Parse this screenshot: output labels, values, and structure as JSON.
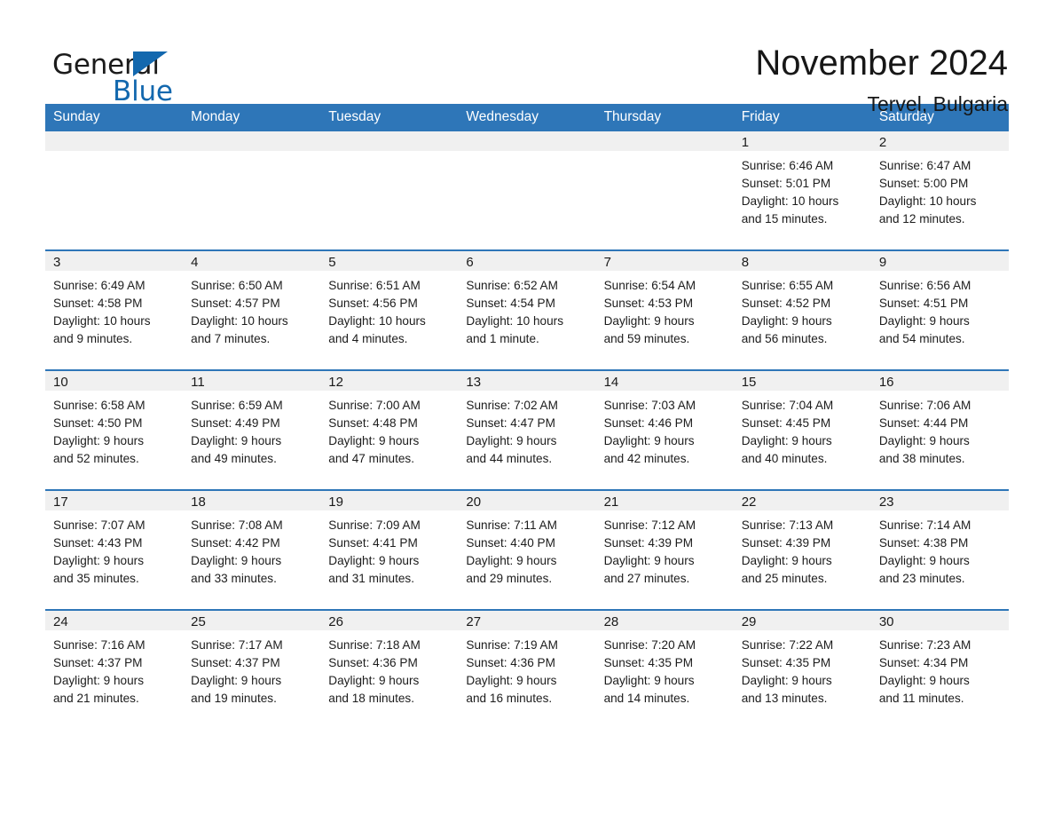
{
  "brand": {
    "name_part1": "General",
    "name_part2": "Blue",
    "accent_color": "#1368ae",
    "triangle_icon": "brand-triangle-icon"
  },
  "header": {
    "month_title": "November 2024",
    "location": "Tervel, Bulgaria",
    "header_bg_color": "#2e76b8",
    "header_text_color": "#ffffff",
    "daynum_strip_color": "#f0f0f0"
  },
  "weekdays": [
    "Sunday",
    "Monday",
    "Tuesday",
    "Wednesday",
    "Thursday",
    "Friday",
    "Saturday"
  ],
  "labels": {
    "sunrise_prefix": "Sunrise:",
    "sunset_prefix": "Sunset:",
    "daylight_prefix": "Daylight:"
  },
  "weeks": [
    [
      {
        "day": "",
        "empty": true,
        "sunrise": "",
        "sunset": "",
        "daylight_line1": "",
        "daylight_line2": ""
      },
      {
        "day": "",
        "empty": true,
        "sunrise": "",
        "sunset": "",
        "daylight_line1": "",
        "daylight_line2": ""
      },
      {
        "day": "",
        "empty": true,
        "sunrise": "",
        "sunset": "",
        "daylight_line1": "",
        "daylight_line2": ""
      },
      {
        "day": "",
        "empty": true,
        "sunrise": "",
        "sunset": "",
        "daylight_line1": "",
        "daylight_line2": ""
      },
      {
        "day": "",
        "empty": true,
        "sunrise": "",
        "sunset": "",
        "daylight_line1": "",
        "daylight_line2": ""
      },
      {
        "day": "1",
        "empty": false,
        "sunrise": "Sunrise: 6:46 AM",
        "sunset": "Sunset: 5:01 PM",
        "daylight_line1": "Daylight: 10 hours",
        "daylight_line2": "and 15 minutes."
      },
      {
        "day": "2",
        "empty": false,
        "sunrise": "Sunrise: 6:47 AM",
        "sunset": "Sunset: 5:00 PM",
        "daylight_line1": "Daylight: 10 hours",
        "daylight_line2": "and 12 minutes."
      }
    ],
    [
      {
        "day": "3",
        "empty": false,
        "sunrise": "Sunrise: 6:49 AM",
        "sunset": "Sunset: 4:58 PM",
        "daylight_line1": "Daylight: 10 hours",
        "daylight_line2": "and 9 minutes."
      },
      {
        "day": "4",
        "empty": false,
        "sunrise": "Sunrise: 6:50 AM",
        "sunset": "Sunset: 4:57 PM",
        "daylight_line1": "Daylight: 10 hours",
        "daylight_line2": "and 7 minutes."
      },
      {
        "day": "5",
        "empty": false,
        "sunrise": "Sunrise: 6:51 AM",
        "sunset": "Sunset: 4:56 PM",
        "daylight_line1": "Daylight: 10 hours",
        "daylight_line2": "and 4 minutes."
      },
      {
        "day": "6",
        "empty": false,
        "sunrise": "Sunrise: 6:52 AM",
        "sunset": "Sunset: 4:54 PM",
        "daylight_line1": "Daylight: 10 hours",
        "daylight_line2": "and 1 minute."
      },
      {
        "day": "7",
        "empty": false,
        "sunrise": "Sunrise: 6:54 AM",
        "sunset": "Sunset: 4:53 PM",
        "daylight_line1": "Daylight: 9 hours",
        "daylight_line2": "and 59 minutes."
      },
      {
        "day": "8",
        "empty": false,
        "sunrise": "Sunrise: 6:55 AM",
        "sunset": "Sunset: 4:52 PM",
        "daylight_line1": "Daylight: 9 hours",
        "daylight_line2": "and 56 minutes."
      },
      {
        "day": "9",
        "empty": false,
        "sunrise": "Sunrise: 6:56 AM",
        "sunset": "Sunset: 4:51 PM",
        "daylight_line1": "Daylight: 9 hours",
        "daylight_line2": "and 54 minutes."
      }
    ],
    [
      {
        "day": "10",
        "empty": false,
        "sunrise": "Sunrise: 6:58 AM",
        "sunset": "Sunset: 4:50 PM",
        "daylight_line1": "Daylight: 9 hours",
        "daylight_line2": "and 52 minutes."
      },
      {
        "day": "11",
        "empty": false,
        "sunrise": "Sunrise: 6:59 AM",
        "sunset": "Sunset: 4:49 PM",
        "daylight_line1": "Daylight: 9 hours",
        "daylight_line2": "and 49 minutes."
      },
      {
        "day": "12",
        "empty": false,
        "sunrise": "Sunrise: 7:00 AM",
        "sunset": "Sunset: 4:48 PM",
        "daylight_line1": "Daylight: 9 hours",
        "daylight_line2": "and 47 minutes."
      },
      {
        "day": "13",
        "empty": false,
        "sunrise": "Sunrise: 7:02 AM",
        "sunset": "Sunset: 4:47 PM",
        "daylight_line1": "Daylight: 9 hours",
        "daylight_line2": "and 44 minutes."
      },
      {
        "day": "14",
        "empty": false,
        "sunrise": "Sunrise: 7:03 AM",
        "sunset": "Sunset: 4:46 PM",
        "daylight_line1": "Daylight: 9 hours",
        "daylight_line2": "and 42 minutes."
      },
      {
        "day": "15",
        "empty": false,
        "sunrise": "Sunrise: 7:04 AM",
        "sunset": "Sunset: 4:45 PM",
        "daylight_line1": "Daylight: 9 hours",
        "daylight_line2": "and 40 minutes."
      },
      {
        "day": "16",
        "empty": false,
        "sunrise": "Sunrise: 7:06 AM",
        "sunset": "Sunset: 4:44 PM",
        "daylight_line1": "Daylight: 9 hours",
        "daylight_line2": "and 38 minutes."
      }
    ],
    [
      {
        "day": "17",
        "empty": false,
        "sunrise": "Sunrise: 7:07 AM",
        "sunset": "Sunset: 4:43 PM",
        "daylight_line1": "Daylight: 9 hours",
        "daylight_line2": "and 35 minutes."
      },
      {
        "day": "18",
        "empty": false,
        "sunrise": "Sunrise: 7:08 AM",
        "sunset": "Sunset: 4:42 PM",
        "daylight_line1": "Daylight: 9 hours",
        "daylight_line2": "and 33 minutes."
      },
      {
        "day": "19",
        "empty": false,
        "sunrise": "Sunrise: 7:09 AM",
        "sunset": "Sunset: 4:41 PM",
        "daylight_line1": "Daylight: 9 hours",
        "daylight_line2": "and 31 minutes."
      },
      {
        "day": "20",
        "empty": false,
        "sunrise": "Sunrise: 7:11 AM",
        "sunset": "Sunset: 4:40 PM",
        "daylight_line1": "Daylight: 9 hours",
        "daylight_line2": "and 29 minutes."
      },
      {
        "day": "21",
        "empty": false,
        "sunrise": "Sunrise: 7:12 AM",
        "sunset": "Sunset: 4:39 PM",
        "daylight_line1": "Daylight: 9 hours",
        "daylight_line2": "and 27 minutes."
      },
      {
        "day": "22",
        "empty": false,
        "sunrise": "Sunrise: 7:13 AM",
        "sunset": "Sunset: 4:39 PM",
        "daylight_line1": "Daylight: 9 hours",
        "daylight_line2": "and 25 minutes."
      },
      {
        "day": "23",
        "empty": false,
        "sunrise": "Sunrise: 7:14 AM",
        "sunset": "Sunset: 4:38 PM",
        "daylight_line1": "Daylight: 9 hours",
        "daylight_line2": "and 23 minutes."
      }
    ],
    [
      {
        "day": "24",
        "empty": false,
        "sunrise": "Sunrise: 7:16 AM",
        "sunset": "Sunset: 4:37 PM",
        "daylight_line1": "Daylight: 9 hours",
        "daylight_line2": "and 21 minutes."
      },
      {
        "day": "25",
        "empty": false,
        "sunrise": "Sunrise: 7:17 AM",
        "sunset": "Sunset: 4:37 PM",
        "daylight_line1": "Daylight: 9 hours",
        "daylight_line2": "and 19 minutes."
      },
      {
        "day": "26",
        "empty": false,
        "sunrise": "Sunrise: 7:18 AM",
        "sunset": "Sunset: 4:36 PM",
        "daylight_line1": "Daylight: 9 hours",
        "daylight_line2": "and 18 minutes."
      },
      {
        "day": "27",
        "empty": false,
        "sunrise": "Sunrise: 7:19 AM",
        "sunset": "Sunset: 4:36 PM",
        "daylight_line1": "Daylight: 9 hours",
        "daylight_line2": "and 16 minutes."
      },
      {
        "day": "28",
        "empty": false,
        "sunrise": "Sunrise: 7:20 AM",
        "sunset": "Sunset: 4:35 PM",
        "daylight_line1": "Daylight: 9 hours",
        "daylight_line2": "and 14 minutes."
      },
      {
        "day": "29",
        "empty": false,
        "sunrise": "Sunrise: 7:22 AM",
        "sunset": "Sunset: 4:35 PM",
        "daylight_line1": "Daylight: 9 hours",
        "daylight_line2": "and 13 minutes."
      },
      {
        "day": "30",
        "empty": false,
        "sunrise": "Sunrise: 7:23 AM",
        "sunset": "Sunset: 4:34 PM",
        "daylight_line1": "Daylight: 9 hours",
        "daylight_line2": "and 11 minutes."
      }
    ]
  ]
}
